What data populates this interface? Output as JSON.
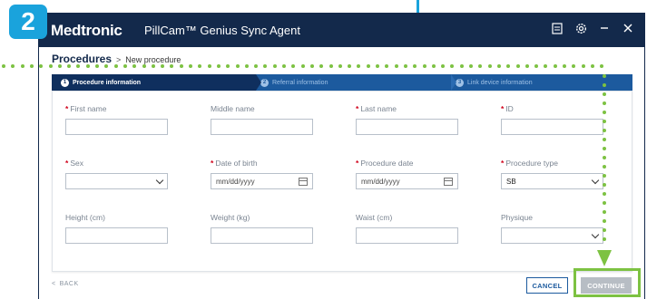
{
  "annotation": {
    "step_number": "2"
  },
  "window": {
    "brand": "Medtronic",
    "title": "PillCam™ Genius Sync Agent"
  },
  "breadcrumb": {
    "root": "Procedures",
    "separator": ">",
    "current": "New procedure"
  },
  "stepper": [
    {
      "number": "1",
      "label": "Procedure information"
    },
    {
      "number": "2",
      "label": "Referral information"
    },
    {
      "number": "3",
      "label": "Link device information"
    }
  ],
  "form": {
    "first_name": {
      "label": "First name",
      "value": ""
    },
    "middle_name": {
      "label": "Middle name",
      "value": ""
    },
    "last_name": {
      "label": "Last name",
      "value": ""
    },
    "id": {
      "label": "ID",
      "value": ""
    },
    "sex": {
      "label": "Sex",
      "value": ""
    },
    "date_of_birth": {
      "label": "Date of birth",
      "placeholder": "mm/dd/yyyy"
    },
    "procedure_date": {
      "label": "Procedure date",
      "placeholder": "mm/dd/yyyy"
    },
    "procedure_type": {
      "label": "Procedure type",
      "value": "SB"
    },
    "height": {
      "label": "Height (cm)",
      "value": ""
    },
    "weight": {
      "label": "Weight (kg)",
      "value": ""
    },
    "waist": {
      "label": "Waist (cm)",
      "value": ""
    },
    "physique": {
      "label": "Physique",
      "value": ""
    }
  },
  "footer": {
    "back_arrow": "<",
    "back_label": "BACK",
    "cancel_label": "CANCEL",
    "continue_label": "CONTINUE"
  },
  "colors": {
    "window_bg": "#13294b",
    "stepper_bg": "#1c5a9e",
    "annotation_blue": "#1aa3dc",
    "annotation_green": "#7dc242",
    "required_red": "#d0021b"
  },
  "icons": {
    "clipboard": "clipboard-icon",
    "settings": "gear-icon",
    "minimize": "minimize-icon",
    "close": "close-icon",
    "calendar": "calendar-icon",
    "dropdown": "chevron-down-icon"
  }
}
